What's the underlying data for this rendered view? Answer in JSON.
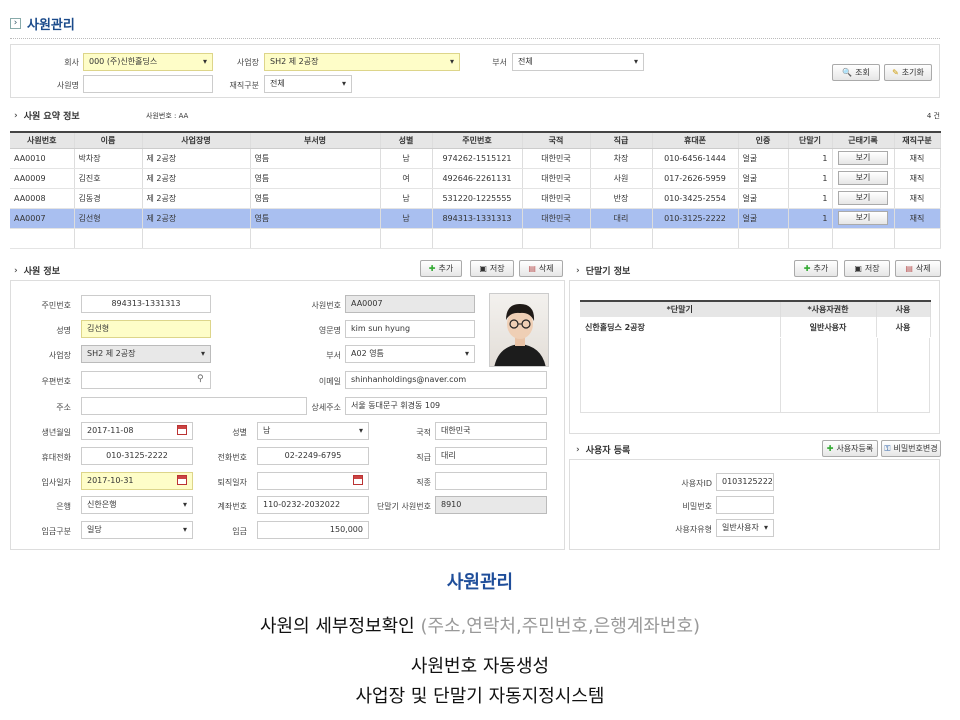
{
  "header": {
    "title": "사원관리"
  },
  "filter": {
    "company_label": "회사",
    "company_value": "000 (주)신한홀딩스",
    "site_label": "사업장",
    "site_value": "SH2 제 2공장",
    "dept_label": "부서",
    "dept_value": "전체",
    "name_label": "사원명",
    "name_value": "",
    "status_label": "재직구분",
    "status_value": "전체",
    "search_btn": "조회",
    "reset_btn": "초기화"
  },
  "summary": {
    "title": "사원 요약 정보",
    "sub": "사원번호 : AA",
    "count": "4 건",
    "columns": [
      "사원번호",
      "이름",
      "사업장명",
      "부서명",
      "성별",
      "주민번호",
      "국적",
      "직급",
      "휴대폰",
      "인증",
      "단말기",
      "근태기록",
      "재직구분"
    ],
    "view_btn": "보기",
    "rows": [
      [
        "AA0010",
        "박차장",
        "제 2공장",
        "영틈",
        "남",
        "974262-1515121",
        "대한민국",
        "차장",
        "010-6456-1444",
        "얼굴",
        "1",
        "보기",
        "재직"
      ],
      [
        "AA0009",
        "김진호",
        "제 2공장",
        "영틈",
        "여",
        "492646-2261131",
        "대한민국",
        "사원",
        "017-2626-5959",
        "얼굴",
        "1",
        "보기",
        "재직"
      ],
      [
        "AA0008",
        "김동경",
        "제 2공장",
        "영틈",
        "남",
        "531220-1225555",
        "대한민국",
        "반장",
        "010-3425-2554",
        "얼굴",
        "1",
        "보기",
        "재직"
      ],
      [
        "AA0007",
        "김선형",
        "제 2공장",
        "영틈",
        "남",
        "894313-1331313",
        "대한민국",
        "대리",
        "010-3125-2222",
        "얼굴",
        "1",
        "보기",
        "재직"
      ]
    ]
  },
  "employee": {
    "title": "사원 정보",
    "add": "추가",
    "save": "저장",
    "del": "삭제",
    "rrn_label": "주민번호",
    "rrn": "894313-1331313",
    "empno_label": "사원번호",
    "empno": "AA0007",
    "name_label": "성명",
    "name": "김선형",
    "eng_label": "영문명",
    "eng": "kim sun hyung",
    "site_label": "사업장",
    "site": "SH2 제 2공장",
    "dept_label": "부서",
    "dept": "A02 영틈",
    "zip_label": "우편번호",
    "zip": "",
    "email_label": "이메일",
    "email": "shinhanholdings@naver.com",
    "addr_label": "주소",
    "addr": "",
    "addr2_label": "상세주소",
    "addr2": "서울 동대문구 휘경동 109",
    "birth_label": "생년월일",
    "birth": "2017-11-08",
    "gender_label": "성별",
    "gender": "남",
    "nation_label": "국적",
    "nation": "대한민국",
    "mobile_label": "휴대전화",
    "mobile": "010-3125-2222",
    "phone_label": "전화번호",
    "phone": "02-2249-6795",
    "rank_label": "직급",
    "rank": "대리",
    "join_label": "입사일자",
    "join": "2017-10-31",
    "leave_label": "퇴직일자",
    "leave": "",
    "duty_label": "직종",
    "duty": "",
    "bank_label": "은행",
    "bank": "신한은행",
    "acct_label": "계좌번호",
    "acct": "110-0232-2032022",
    "term_label": "단말기 사원번호",
    "term": "8910",
    "paytype_label": "임금구분",
    "paytype": "일당",
    "wage_label": "임금",
    "wage": "150,000"
  },
  "terminal": {
    "title": "단말기 정보",
    "add": "추가",
    "save": "저장",
    "del": "삭제",
    "columns": [
      "*단말기",
      "*사용자권한",
      "사용"
    ],
    "rows": [
      [
        "신한홀딩스 2공장",
        "일반사용자",
        "사용"
      ]
    ]
  },
  "user": {
    "title": "사용자 등록",
    "reg_btn": "사용자등록",
    "pw_btn": "비밀번호변경",
    "id_label": "사용자ID",
    "id": "01031252222",
    "pw_label": "비밀번호",
    "pw": "",
    "type_label": "사용자유형",
    "type": "일반사용자"
  },
  "captions": {
    "c1": "사원관리",
    "c2": "사원의 세부정보확인 ",
    "c2b": "(주소,연락처,주민번호,은행계좌번호)",
    "c3": "사원번호 자동생성",
    "c4": "사업장 및 단말기 자동지정시스템"
  }
}
